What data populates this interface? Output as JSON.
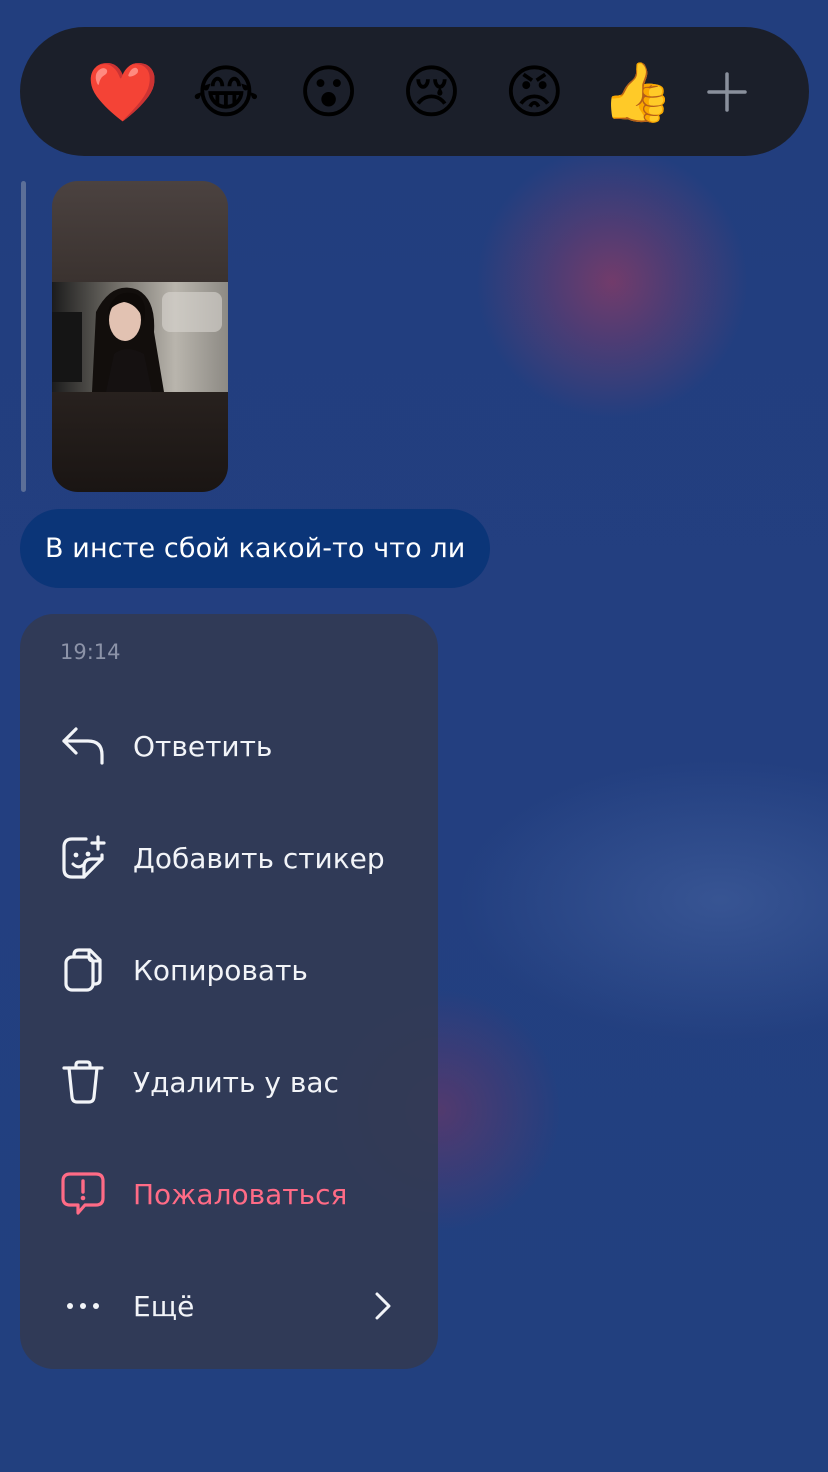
{
  "reactions": {
    "items": [
      {
        "name": "heart",
        "glyph": "❤️"
      },
      {
        "name": "laughing",
        "glyph": "😂"
      },
      {
        "name": "surprised",
        "glyph": "😮"
      },
      {
        "name": "crying",
        "glyph": "😢"
      },
      {
        "name": "angry",
        "glyph": "😡"
      },
      {
        "name": "thumbs-up",
        "glyph": "👍"
      }
    ],
    "more_icon": "plus-icon"
  },
  "reply": {
    "image_icon": "photo-thumbnail"
  },
  "message": {
    "text": "В инсте сбой какой-то что ли"
  },
  "menu": {
    "time": "19:14",
    "items": [
      {
        "label": "Ответить",
        "icon": "reply-icon"
      },
      {
        "label": "Добавить стикер",
        "icon": "sticker-add-icon"
      },
      {
        "label": "Копировать",
        "icon": "copy-icon"
      },
      {
        "label": "Удалить у вас",
        "icon": "trash-icon"
      },
      {
        "label": "Пожаловаться",
        "icon": "report-icon"
      },
      {
        "label": "Ещё",
        "icon": "more-dots-icon"
      }
    ]
  },
  "colors": {
    "background": "#223f80",
    "reaction_bar": "#1b1f2a",
    "bubble": "#0b3578",
    "menu": "#323a54",
    "danger": "#ff6b86",
    "muted": "#8c93a8"
  }
}
